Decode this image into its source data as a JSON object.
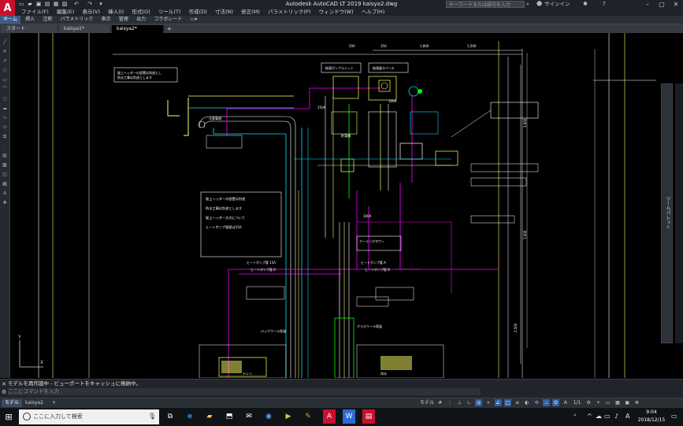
{
  "window": {
    "title": "Autodesk AutoCAD LT 2019   kaisya2.dwg",
    "app_logo_letter": "A",
    "search_placeholder": "キーワードまたは語句を入力",
    "user_label": "サインイン",
    "controls": {
      "minimize": "–",
      "maximize": "▢",
      "close": "✕"
    }
  },
  "menu": [
    "ファイル(F)",
    "編集(E)",
    "表示(V)",
    "挿入(I)",
    "形式(O)",
    "ツール(T)",
    "作成(D)",
    "寸法(N)",
    "修正(M)",
    "パラメトリック(P)",
    "ウィンドウ(W)",
    "ヘルプ(H)"
  ],
  "ribbon_tabs": [
    "ホーム",
    "挿入",
    "注釈",
    "パラメトリック",
    "表示",
    "管理",
    "出力",
    "コラボレート"
  ],
  "ribbon_active": 0,
  "doc_tabs": [
    {
      "label": "スタート",
      "active": false
    },
    {
      "label": "kaisya1*",
      "active": false
    },
    {
      "label": "kaisya2*",
      "active": true
    }
  ],
  "drawing": {
    "notes_yellow": [
      "屋上ヘッダーの設置は別途",
      "防水工事は別途とします",
      "屋上ヘッダー方式について",
      "ヒートポンプ管理は15A"
    ],
    "labels": {
      "heatpump_a": "ヒートポンプ管 A",
      "heatpump_b": "ヒートポンプ管 B",
      "heatpump_15a": "ヒートポンプ管 15A",
      "heatpump_15a_b": "ヒートポンプ管 B",
      "cooling_tower": "クーリングタワー",
      "attention": "注意事項",
      "pump_unit": "給湯ポンプユニット",
      "boiler": "給湯器スペース",
      "tank_label": "貯湯槽",
      "glass_wool": "グラスウール保温",
      "rock_wool": "ロックウール保温",
      "drain": "ドレン",
      "drain_b": "排水"
    },
    "dims": [
      "1,800",
      "1,500",
      "7,000",
      "2,500",
      "3,600",
      "1,850",
      "1,340",
      "350",
      "500",
      "450",
      "100A",
      "100A",
      "150A"
    ]
  },
  "command": {
    "history1": "モデルを再作図中 - ビューポートをキャッシュに格納中。",
    "prompt_placeholder": "ここにコマンドを入力"
  },
  "layout_tabs": [
    {
      "label": "モデル",
      "active": true
    },
    {
      "label": "kaisya2",
      "active": false
    }
  ],
  "status": {
    "model_label": "モデル",
    "scale": "1/1"
  },
  "right_palette": {
    "label": "ツールパレット"
  },
  "taskbar": {
    "search_placeholder": "ここに入力して検索",
    "time": "9:04",
    "date": "2018/12/15",
    "ime": "A"
  },
  "colors": {
    "title_bg": "#1e2229",
    "autocad_red": "#c8102e",
    "cad_cyan": "#00e5ff",
    "cad_yellow": "#ffff00",
    "cad_magenta": "#ff00ff",
    "cad_green": "#00ff00",
    "cad_white": "#ffffff"
  }
}
